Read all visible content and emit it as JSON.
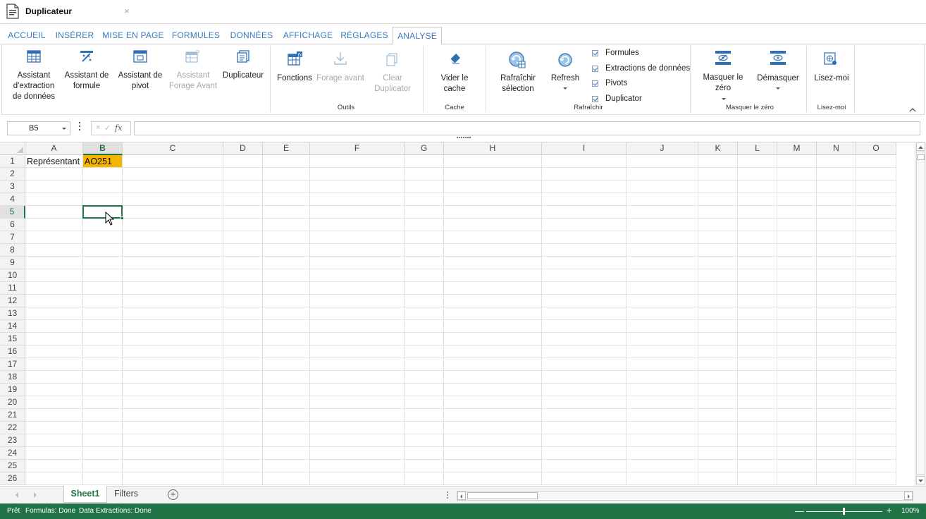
{
  "document": {
    "title": "Duplicateur",
    "close_glyph": "×"
  },
  "ribbon_tabs": [
    "ACCUEIL",
    "INSÉRER",
    "MISE EN PAGE",
    "FORMULES",
    "DONNÉES",
    "AFFICHAGE",
    "RÉGLAGES",
    "ANALYSE"
  ],
  "active_tab": "ANALYSE",
  "ribbon": {
    "buttons": {
      "assistant_extraction": "Assistant d'extraction de données",
      "assistant_formule": "Assistant de formule",
      "assistant_pivot": "Assistant de pivot",
      "assistant_forage": "Assistant Forage Avant",
      "duplicateur": "Duplicateur",
      "fonctions": "Fonctions",
      "forage_avant": "Forage avant",
      "clear_duplicator": "Clear Duplicator",
      "vider_cache": "Vider le cache",
      "rafraichir_selection": "Rafraîchir sélection",
      "refresh": "Refresh",
      "masquer_zero": "Masquer le zéro",
      "demasquer": "Démasquer",
      "lisez_moi": "Lisez-moi"
    },
    "checkboxes": [
      "Formules",
      "Extractions de données",
      "Pivots",
      "Duplicator"
    ],
    "group_labels": {
      "outils": "Outils",
      "cache": "Cache",
      "rafraichir": "Rafraîchir",
      "masquer": "Masquer le zéro",
      "lisez": "Lisez-moi"
    }
  },
  "formula_bar": {
    "name_box": "B5",
    "fx": "fx",
    "cancel": "×",
    "confirm": "✓",
    "formula": ""
  },
  "grid": {
    "columns": [
      "A",
      "B",
      "C",
      "D",
      "E",
      "F",
      "G",
      "H",
      "I",
      "J",
      "K",
      "L",
      "M",
      "N",
      "O"
    ],
    "rows": [
      "1",
      "2",
      "3",
      "4",
      "5",
      "6",
      "7",
      "8",
      "9",
      "10",
      "11",
      "12",
      "13",
      "14",
      "15",
      "16",
      "17",
      "18",
      "19",
      "20",
      "21",
      "22",
      "23",
      "24",
      "25",
      "26"
    ],
    "selected_cell": "B5",
    "selected_col": "B",
    "selected_row": "5",
    "cells": {
      "A1": "Représentant",
      "B1": "AO251"
    },
    "highlight_color": "#f5b400"
  },
  "sheets": {
    "tabs": [
      "Sheet1",
      "Filters"
    ],
    "active": "Sheet1"
  },
  "status": {
    "ready": "Prêt",
    "formulas": "Formulas: Done",
    "extractions": "Data Extractions: Done",
    "zoom": "100%",
    "zoom_level": 1.0
  },
  "colors": {
    "accent": "#217346",
    "tab_text": "#3c7ac0",
    "icon_blue": "#2f6fb3"
  }
}
